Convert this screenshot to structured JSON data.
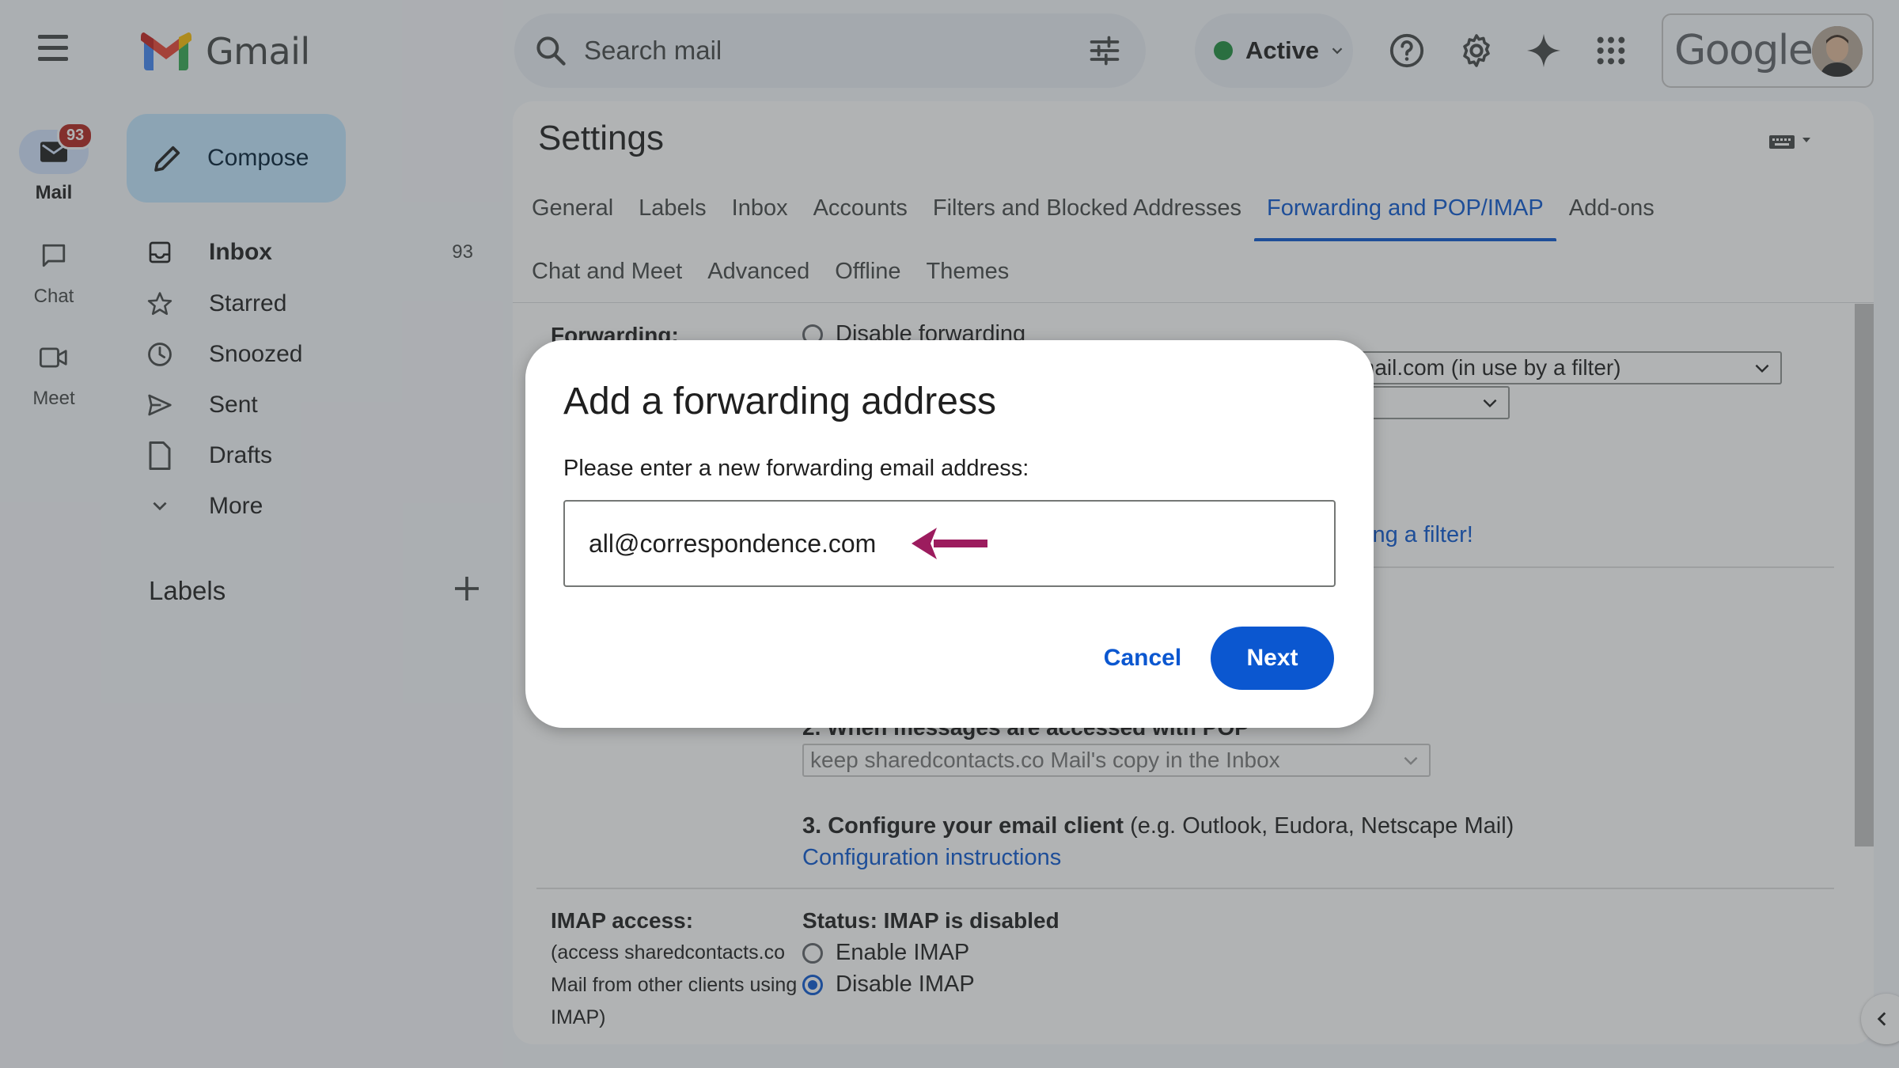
{
  "topbar": {
    "app_name": "Gmail",
    "search_placeholder": "Search mail",
    "status_label": "Active",
    "status_color": "#1e8e3e",
    "brand_text": "Google",
    "icons": [
      "menu-icon",
      "search-icon",
      "search-options-icon",
      "help-icon",
      "settings-icon",
      "gemini-sparkle-icon",
      "apps-grid-icon"
    ]
  },
  "rail": {
    "items": [
      {
        "label": "Mail",
        "badge": "93",
        "icon": "mail-icon",
        "active": true
      },
      {
        "label": "Chat",
        "icon": "chat-icon"
      },
      {
        "label": "Meet",
        "icon": "video-icon"
      }
    ]
  },
  "nav": {
    "compose_label": "Compose",
    "items": [
      {
        "label": "Inbox",
        "count": "93",
        "icon": "inbox-icon"
      },
      {
        "label": "Starred",
        "icon": "star-icon"
      },
      {
        "label": "Snoozed",
        "icon": "clock-icon"
      },
      {
        "label": "Sent",
        "icon": "send-icon"
      },
      {
        "label": "Drafts",
        "icon": "draft-icon"
      },
      {
        "label": "More",
        "icon": "chevron-down-icon"
      }
    ],
    "labels_title": "Labels"
  },
  "settings": {
    "title": "Settings",
    "tabs_row1": [
      "General",
      "Labels",
      "Inbox",
      "Accounts",
      "Filters and Blocked Addresses",
      "Forwarding and POP/IMAP",
      "Add-ons"
    ],
    "tabs_row2": [
      "Chat and Meet",
      "Advanced",
      "Offline",
      "Themes"
    ],
    "active_tab": "Forwarding and POP/IMAP",
    "forwarding": {
      "label": "Forwarding:",
      "disable_option": "Disable forwarding",
      "forward_select_value": "@gmail.com (in use by a filter)",
      "filter_link_fragment": "ing a filter!"
    },
    "pop": {
      "step2_label": "2. When messages are accessed with POP",
      "step2_select_value": "keep sharedcontacts.co Mail's copy in the Inbox",
      "step3_bold": "3. Configure your email client",
      "step3_rest": " (e.g. Outlook, Eudora, Netscape Mail)",
      "config_link": "Configuration instructions"
    },
    "imap": {
      "label": "IMAP access:",
      "desc_line1": "(access sharedcontacts.co",
      "desc_line2": "Mail from other clients using",
      "desc_line3": "IMAP)",
      "status": "Status: IMAP is disabled",
      "enable_option": "Enable IMAP",
      "disable_option": "Disable IMAP",
      "selected": "Disable IMAP"
    }
  },
  "dialog": {
    "title": "Add a forwarding address",
    "prompt": "Please enter a new forwarding email address:",
    "input_value": "all@correspondence.com",
    "cancel_label": "Cancel",
    "next_label": "Next",
    "accent_color": "#0b57d0",
    "annotation_arrow_color": "#9c1c5e"
  }
}
